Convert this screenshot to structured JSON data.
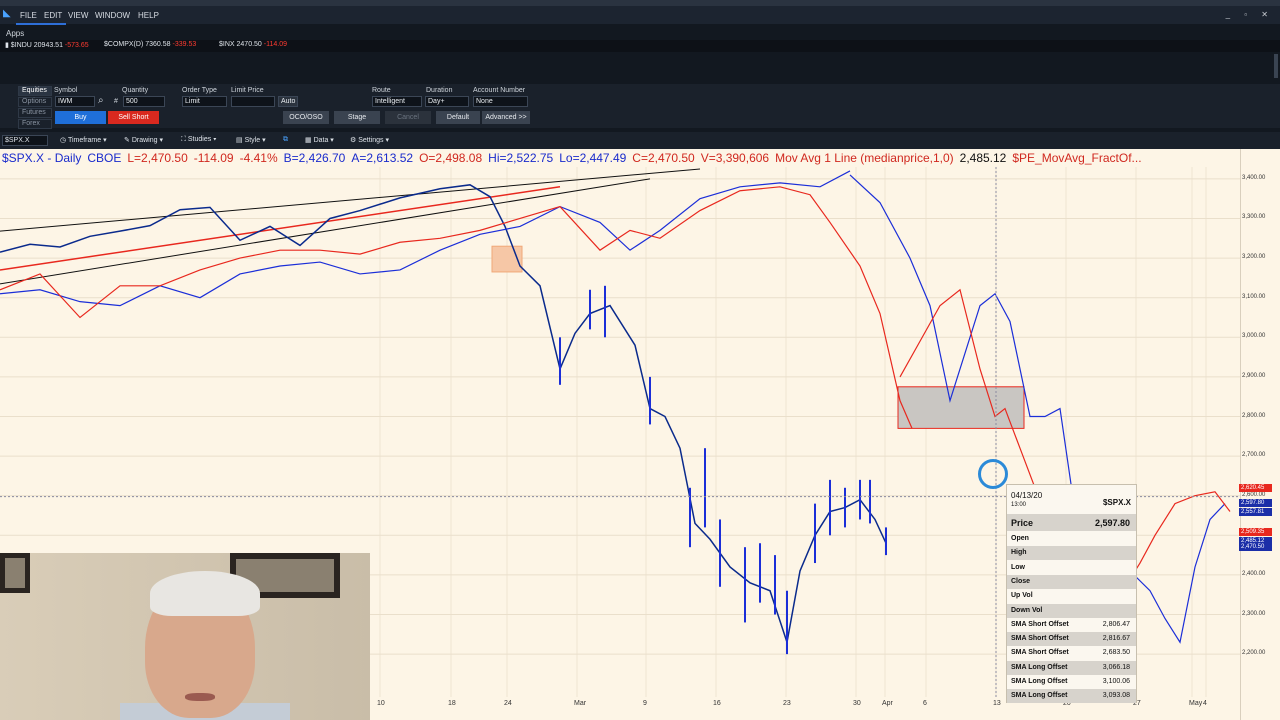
{
  "menu": {
    "items": [
      "FILE",
      "EDIT",
      "VIEW",
      "WINDOW",
      "HELP"
    ]
  },
  "apps_label": "Apps",
  "tickers": [
    {
      "symbol": "$INDU",
      "value": "20943.51",
      "change": "-573.65"
    },
    {
      "symbol": "$COMPX(D)",
      "value": "7360.58",
      "change": "-339.53"
    },
    {
      "symbol": "$INX",
      "value": "2470.50",
      "change": "-114.09"
    }
  ],
  "order_bar": {
    "tabs": [
      "Equities",
      "Options",
      "Futures",
      "Forex"
    ],
    "symbol_label": "Symbol",
    "symbol_value": "IWM",
    "quantity_label": "Quantity",
    "quantity_value": "500",
    "quantity_hash": "#",
    "order_type_label": "Order Type",
    "order_type_value": "Limit",
    "limit_price_label": "Limit Price",
    "limit_price_value": "",
    "auto_label": "Auto",
    "buy_label": "Buy",
    "sell_short_label": "Sell Short",
    "route_label": "Route",
    "route_value": "Intelligent",
    "duration_label": "Duration",
    "duration_value": "Day+",
    "account_label": "Account Number",
    "account_value": "None",
    "oco_label": "OCO/OSO",
    "stage_label": "Stage",
    "cancel_label": "Cancel",
    "default_label": "Default",
    "advanced_label": "Advanced >>"
  },
  "chart_toolbar": {
    "symbol": "$SPX.X",
    "timeframe": "Timeframe",
    "drawing": "Drawing",
    "studies": "Studies",
    "style": "Style",
    "data": "Data",
    "settings": "Settings"
  },
  "chart_header": {
    "symbol": "$SPX.X - Daily",
    "exchange": "CBOE",
    "last": "L=2,470.50",
    "chg": "-114.09",
    "pct": "-4.41%",
    "bid": "B=2,426.70",
    "ask": "A=2,613.52",
    "open": "O=2,498.08",
    "hi": "Hi=2,522.75",
    "lo": "Lo=2,447.49",
    "close": "C=2,470.50",
    "vol": "V=3,390,606",
    "mov_avg": "Mov Avg 1 Line (medianprice,1,0)",
    "mov_avg_val": "2,485.12",
    "study": "$PE_MovAvg_FractOf..."
  },
  "chart_data": {
    "type": "line",
    "y_axis_labels": [
      "3,400.00",
      "3,300.00",
      "3,200.00",
      "3,100.00",
      "3,000.00",
      "2,900.00",
      "2,800.00",
      "2,700.00",
      "2,600.00",
      "2,500.00",
      "2,400.00",
      "2,300.00",
      "2,200.00"
    ],
    "x_axis_labels": [
      "10",
      "18",
      "24",
      "Mar",
      "9",
      "16",
      "23",
      "30",
      "Apr",
      "6",
      "13",
      "20",
      "27",
      "May",
      "4"
    ],
    "price_tags": [
      {
        "label": "2,620.45",
        "color": "#e8281e"
      },
      {
        "label": "2,597.80",
        "color": "#1b2ea8"
      },
      {
        "label": "2,557.81",
        "color": "#1b2ea8"
      },
      {
        "label": "2,509.35",
        "color": "#e8281e"
      },
      {
        "label": "2,485.12",
        "color": "#1b2ea8"
      },
      {
        "label": "2,470.50",
        "color": "#1b2ea8"
      }
    ],
    "ylim": [
      2170,
      3430
    ],
    "colors": {
      "price": "#0a2a8c",
      "blue_projection": "#1b2ed8",
      "red_projection": "#e8281e",
      "channel": "#111111"
    }
  },
  "tooltip": {
    "date": "04/13/20",
    "time": "13:00",
    "symbol": "$SPX.X",
    "price_label": "Price",
    "price_value": "2,597.80",
    "rows": [
      {
        "k": "Open",
        "v": ""
      },
      {
        "k": "High",
        "v": ""
      },
      {
        "k": "Low",
        "v": ""
      },
      {
        "k": "Close",
        "v": ""
      },
      {
        "k": "Up Vol",
        "v": ""
      },
      {
        "k": "Down Vol",
        "v": ""
      },
      {
        "k": "SMA Short Offset",
        "v": "2,806.47"
      },
      {
        "k": "SMA Short Offset",
        "v": "2,816.67"
      },
      {
        "k": "SMA Short Offset",
        "v": "2,683.50"
      },
      {
        "k": "SMA Long Offset",
        "v": "3,066.18"
      },
      {
        "k": "SMA Long Offset",
        "v": "3,100.06"
      },
      {
        "k": "SMA Long Offset",
        "v": "3,093.08"
      }
    ]
  }
}
